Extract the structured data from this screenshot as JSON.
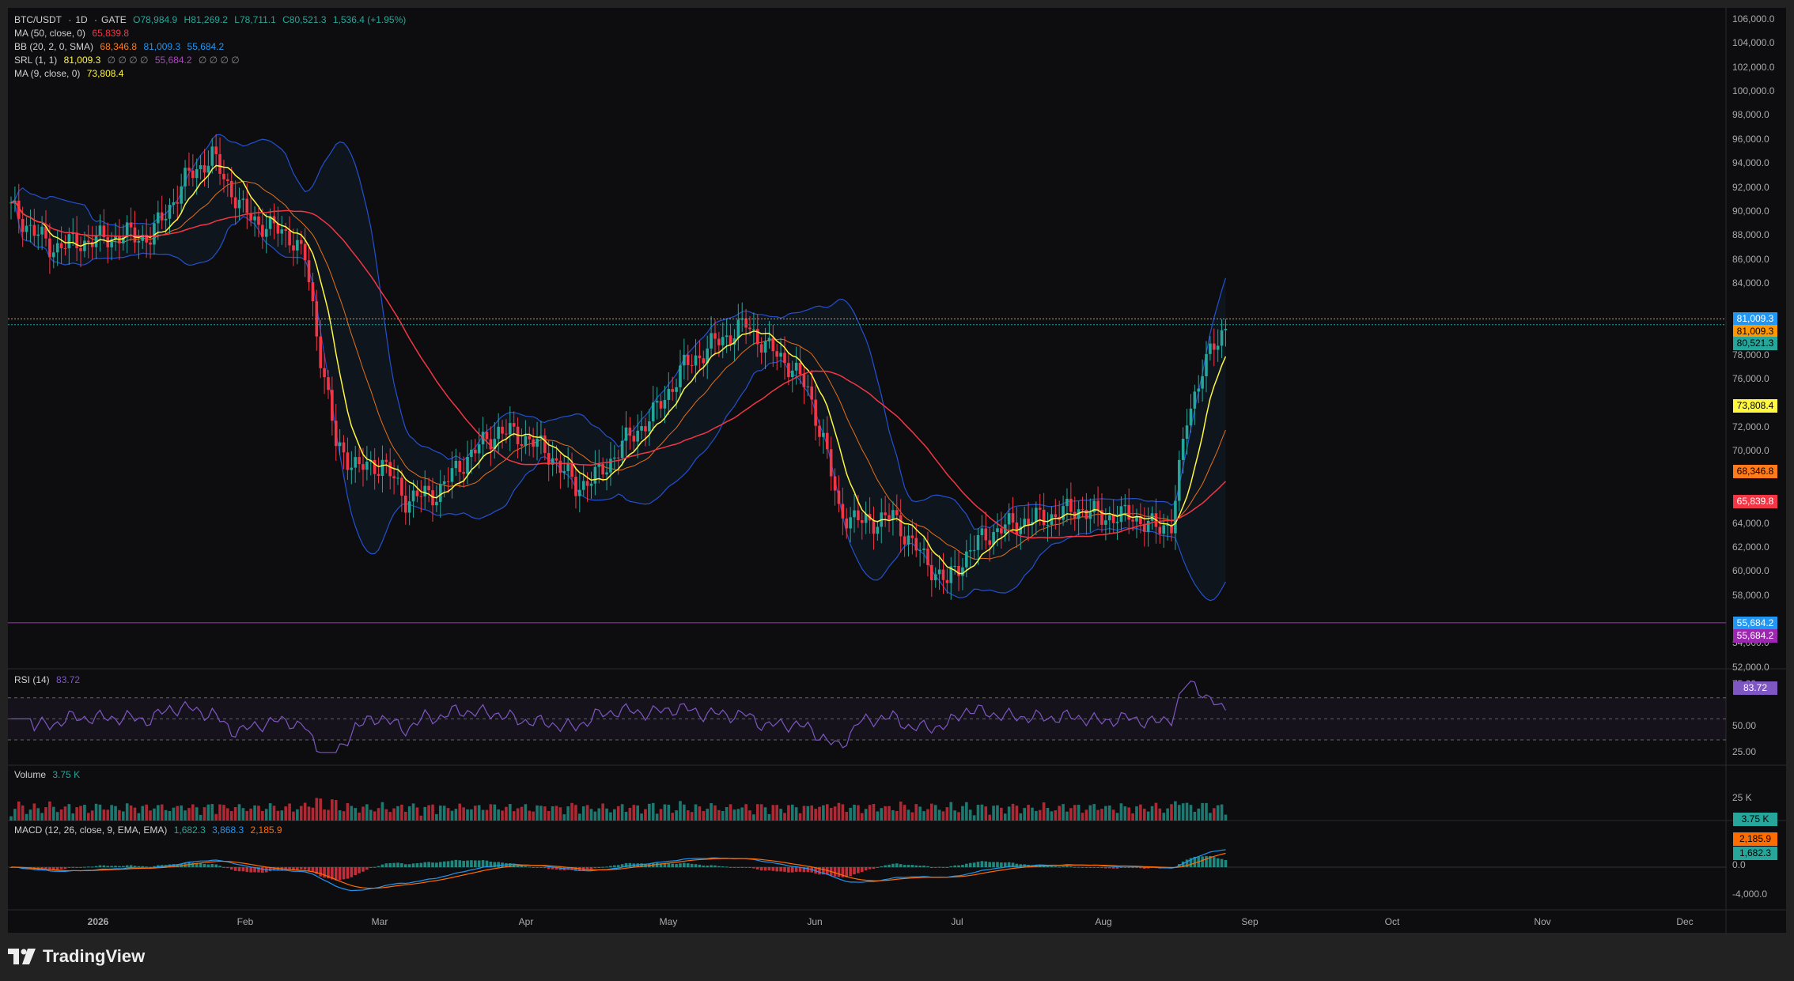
{
  "legend": {
    "title": {
      "symbol": "BTC/USDT",
      "interval": "1D",
      "exchange": "GATE",
      "open": "O78,984.9",
      "high": "H81,269.2",
      "low": "L78,711.1",
      "close": "C80,521.3",
      "change": "1,536.4 (+1.95%)"
    },
    "ma50": {
      "label": "MA (50, close, 0)",
      "value": "65,839.8"
    },
    "bb": {
      "label": "BB (20, 2, 0, SMA)",
      "basis": "68,346.8",
      "upper": "81,009.3",
      "lower": "55,684.2"
    },
    "srl": {
      "label": "SRL (1, 1)",
      "v1": "81,009.3",
      "zeros1": "∅ ∅ ∅ ∅",
      "v2": "55,684.2",
      "zeros2": "∅ ∅ ∅ ∅"
    },
    "ma9": {
      "label": "MA (9, close, 0)",
      "value": "73,808.4"
    }
  },
  "price_axis": {
    "ticks": [
      "106,000.0",
      "104,000.0",
      "102,000.0",
      "100,000.0",
      "98,000.0",
      "96,000.0",
      "94,000.0",
      "92,000.0",
      "90,000.0",
      "88,000.0",
      "86,000.0",
      "84,000.0",
      "78,000.0",
      "76,000.0",
      "72,000.0",
      "70,000.0",
      "64,000.0",
      "62,000.0",
      "60,000.0",
      "58,000.0",
      "54,000.0",
      "52,000.0"
    ],
    "tick_values": [
      106000,
      104000,
      102000,
      100000,
      98000,
      96000,
      94000,
      92000,
      90000,
      88000,
      86000,
      84000,
      78000,
      76000,
      72000,
      70000,
      64000,
      62000,
      60000,
      58000,
      54000,
      52000
    ],
    "badges": [
      {
        "text": "81,009.3",
        "price": 81009.3,
        "color": "#2196f3"
      },
      {
        "text": "81,009.3",
        "price": 80000,
        "color": "#ff9800"
      },
      {
        "text": "80,521.3",
        "price": 79000,
        "color": "#26a69a"
      },
      {
        "text": "73,808.4",
        "price": 73808.4,
        "color": "#fff740"
      },
      {
        "text": "68,346.8",
        "price": 68346.8,
        "color": "#ff7a1a"
      },
      {
        "text": "65,839.8",
        "price": 65839.8,
        "color": "#f23645"
      },
      {
        "text": "55,684.2",
        "price": 55684.2,
        "color": "#2196f3"
      },
      {
        "text": "55,684.2",
        "price": 54600,
        "color": "#9c27b0"
      }
    ]
  },
  "rsi": {
    "label": "RSI (14)",
    "value": "83.72",
    "ticks": [
      "75.00",
      "50.00",
      "25.00"
    ]
  },
  "volume": {
    "label": "Volume",
    "value": "3.75 K",
    "tick": "25 K",
    "badge": "3.75 K"
  },
  "macd": {
    "label": "MACD (12, 26, close, 9, EMA, EMA)",
    "macd": "1,682.3",
    "signal": "3,868.3",
    "hist": "2,185.9",
    "ticks": [
      "0.0",
      "-4,000.0"
    ],
    "badges": [
      "2,185.9",
      "1,682.3"
    ]
  },
  "time_axis": [
    "2026",
    "Feb",
    "Mar",
    "Apr",
    "May",
    "Jun",
    "Jul",
    "Aug",
    "Sep",
    "Oct",
    "Nov",
    "Dec"
  ],
  "branding": {
    "name": "TradingView"
  },
  "colors": {
    "up": "#26a69a",
    "down": "#f23645",
    "ma9": "#fff740",
    "ma50": "#f23645",
    "bb_band": "#2962ff",
    "bb_basis": "#ff7a1a",
    "rsi": "#7e57c2",
    "macd": "#2196f3",
    "signal": "#ff6d00",
    "srl": "#9c27b0"
  }
}
